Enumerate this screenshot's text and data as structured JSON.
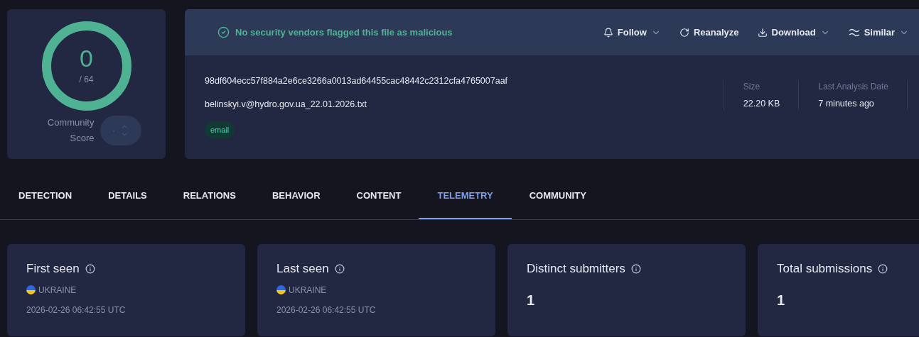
{
  "score": {
    "value": "0",
    "total": "/ 64",
    "label": "Community Score",
    "vote": "·"
  },
  "banner": {
    "message": "No security vendors flagged this file as malicious"
  },
  "actions": [
    {
      "label": "Follow",
      "kind": "bell",
      "dropdown": true
    },
    {
      "label": "Reanalyze",
      "kind": "refresh",
      "dropdown": false
    },
    {
      "label": "Download",
      "kind": "download",
      "dropdown": true
    },
    {
      "label": "Similar",
      "kind": "similar",
      "dropdown": true
    }
  ],
  "file": {
    "hash": "98df604ecc57f884a2e6ce3266a0013ad64455cac48442c2312cfa4765007aaf",
    "name": "belinskyi.v@hydro.gov.ua_22.01.2026.txt",
    "tags": [
      "email"
    ]
  },
  "stats": [
    {
      "label": "Size",
      "value": "22.20 KB"
    },
    {
      "label": "Last Analysis Date",
      "value": "7 minutes ago"
    }
  ],
  "tabs": [
    {
      "label": "DETECTION",
      "selected": false
    },
    {
      "label": "DETAILS",
      "selected": false
    },
    {
      "label": "RELATIONS",
      "selected": false
    },
    {
      "label": "BEHAVIOR",
      "selected": false
    },
    {
      "label": "CONTENT",
      "selected": false
    },
    {
      "label": "TELEMETRY",
      "selected": true
    },
    {
      "label": "COMMUNITY",
      "selected": false
    }
  ],
  "cards": [
    {
      "kind": "location",
      "title": "First seen",
      "country": "UKRAINE",
      "date": "2026-02-26 06:42:55 UTC"
    },
    {
      "kind": "location",
      "title": "Last seen",
      "country": "UKRAINE",
      "date": "2026-02-26 06:42:55 UTC"
    },
    {
      "kind": "count",
      "title": "Distinct submitters",
      "value": "1"
    },
    {
      "kind": "count",
      "title": "Total submissions",
      "value": "1"
    }
  ]
}
